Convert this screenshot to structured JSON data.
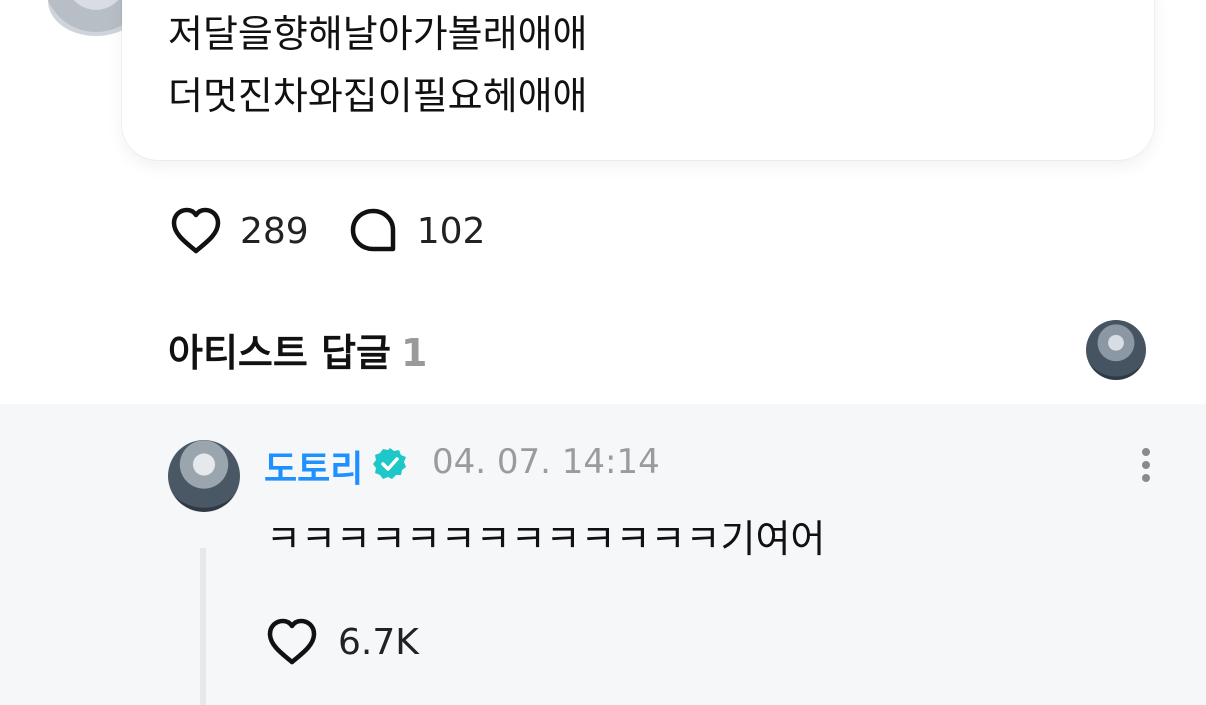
{
  "post": {
    "lines": [
      "저달을향해날아가볼래애애",
      "더멋진차와집이필요헤애애"
    ]
  },
  "reactions": {
    "likes": "289",
    "comments": "102"
  },
  "artist_replies": {
    "title": "아티스트 답글",
    "count": "1"
  },
  "reply": {
    "author": "도토리",
    "timestamp": "04. 07. 14:14",
    "text": "ㅋㅋㅋㅋㅋㅋㅋㅋㅋㅋㅋㅋㅋ기여어",
    "likes": "6.7K"
  },
  "colors": {
    "author_blue": "#1e90ff",
    "verified_teal": "#1ec8c8",
    "reply_bg": "#f6f7f9",
    "muted_text": "#9b9b9b"
  },
  "icons": {
    "like": "heart-outline-icon",
    "comment": "speech-bubble-icon",
    "verified": "verified-badge-icon",
    "more": "vertical-dots-icon"
  }
}
